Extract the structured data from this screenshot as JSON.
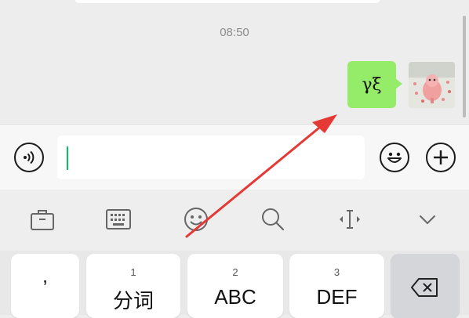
{
  "chat": {
    "timestamp": "08:50",
    "message_text": "γξ"
  },
  "keyboard": {
    "keys": [
      {
        "number": "",
        "label": "’"
      },
      {
        "number": "1",
        "label": "分词"
      },
      {
        "number": "2",
        "label": "ABC"
      },
      {
        "number": "3",
        "label": "DEF"
      }
    ]
  },
  "icons": {
    "voice": "voice-input-icon",
    "emoji": "emoji-icon",
    "plus": "plus-icon",
    "backspace": "backspace-icon"
  },
  "colors": {
    "message_bubble": "#95ec69",
    "caret": "#07c160",
    "arrow": "#e53935"
  }
}
